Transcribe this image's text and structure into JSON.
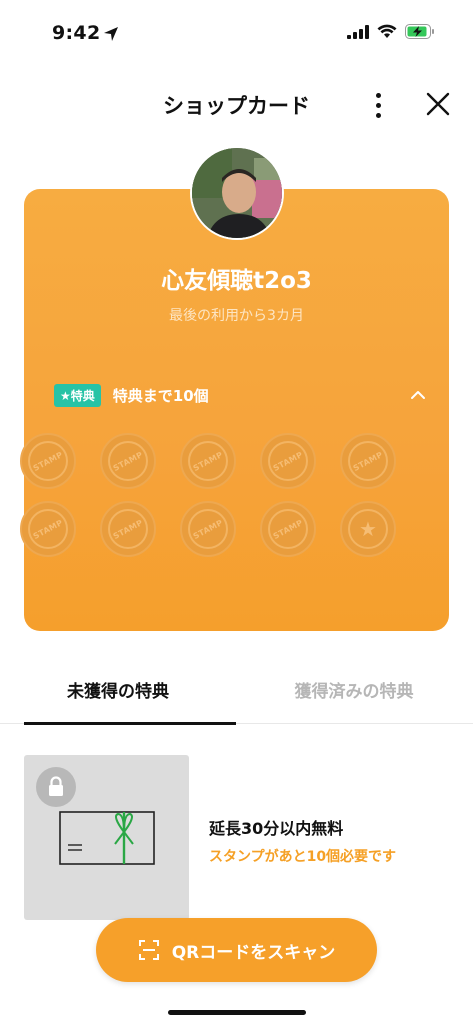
{
  "status_bar": {
    "time": "9:42",
    "icons": [
      "location-arrow-icon",
      "signal-icon",
      "wifi-icon",
      "battery-charging-icon"
    ]
  },
  "header": {
    "title": "ショップカード",
    "more_icon": "more-vertical-icon",
    "close_icon": "close-icon"
  },
  "card": {
    "shop_name": "心友傾聴t2o3",
    "last_use": "最後の利用から3カ月",
    "benefit_badge": "★特典",
    "benefit_text": "特典まで10個",
    "collapse_icon": "chevron-up-icon",
    "stamp_label": "STAMP",
    "stamps_total": 10,
    "stamps_collected": 0,
    "reward_stamp_index": 10,
    "colors": {
      "card": "#f6a33b",
      "badge": "#27c3a6"
    }
  },
  "tabs": [
    {
      "label": "未獲得の特典",
      "active": true
    },
    {
      "label": "獲得済みの特典",
      "active": false
    }
  ],
  "reward": {
    "title": "延長30分以内無料",
    "subtitle": "スタンプがあと10個必要です",
    "lock_icon": "lock-icon",
    "image_icon": "gift-card-icon"
  },
  "qr_button": {
    "label": "QRコードをスキャン",
    "icon": "qr-scan-icon"
  }
}
